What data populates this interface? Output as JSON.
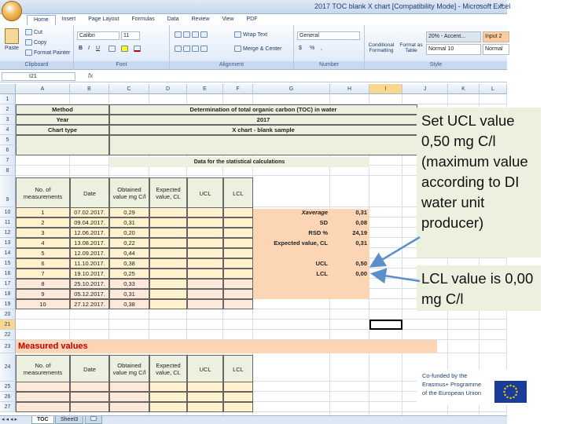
{
  "window": {
    "title": "2017 TOC blank X chart [Compatibility Mode] - Microsoft Excel",
    "controls": [
      "–",
      "▫",
      "×"
    ]
  },
  "ribbon": {
    "tabs": [
      "Home",
      "Insert",
      "Page Layout",
      "Formulas",
      "Data",
      "Review",
      "View",
      "PDF"
    ],
    "active_tab": "Home",
    "clipboard": {
      "paste": "Paste",
      "cut": "Cut",
      "copy": "Copy",
      "format_painter": "Format Painter",
      "label": "Clipboard"
    },
    "font": {
      "family": "Calibri",
      "size": "11",
      "bold": "B",
      "italic": "I",
      "underline": "U",
      "label": "Font"
    },
    "alignment": {
      "wrap": "Wrap Text",
      "merge": "Merge & Center",
      "label": "Alignment"
    },
    "number": {
      "format": "General",
      "currency": "$",
      "percent": "%",
      "comma": ",",
      "label": "Number"
    },
    "styles": {
      "conditional": "Conditional Formatting",
      "format_table": "Format as Table",
      "cells": [
        "20% - Accent...",
        "Input 2",
        "Normal 10",
        "Normal"
      ],
      "label": "Style"
    }
  },
  "formula_bar": {
    "name_box": "I21",
    "fx": "fx"
  },
  "grid": {
    "columns": [
      "A",
      "B",
      "C",
      "D",
      "E",
      "F",
      "G",
      "H",
      "I",
      "J",
      "K",
      "L"
    ],
    "rows": [
      "1",
      "2",
      "3",
      "4",
      "5",
      "6",
      "7",
      "8",
      "9",
      "10",
      "11",
      "12",
      "13",
      "14",
      "15",
      "16",
      "17",
      "18",
      "19",
      "20",
      "21",
      "22",
      "23",
      "24",
      "25",
      "26",
      "27"
    ]
  },
  "sheet": {
    "method_label": "Method",
    "year_label": "Year",
    "chart_type_label": "Chart type",
    "method_value": "Determination of total organic carbon (TOC) in water",
    "year_value": "2017",
    "chart_type_value": "X chart - blank sample",
    "stats_title": "Data for the statistical calculations",
    "headers": [
      "No. of measurements",
      "Date",
      "Obtained value mg C/l",
      "Expected value, CL",
      "UCL",
      "LCL"
    ],
    "measurements": [
      {
        "n": "1",
        "date": "07.02.2017.",
        "value": "0,29"
      },
      {
        "n": "2",
        "date": "09.04.2017.",
        "value": "0,31"
      },
      {
        "n": "3",
        "date": "12.06.2017.",
        "value": "0,20"
      },
      {
        "n": "4",
        "date": "13.08.2017.",
        "value": "0,22"
      },
      {
        "n": "5",
        "date": "12.09.2017.",
        "value": "0,44"
      },
      {
        "n": "6",
        "date": "11.10.2017.",
        "value": "0,38"
      },
      {
        "n": "7",
        "date": "19.10.2017.",
        "value": "0,25"
      },
      {
        "n": "8",
        "date": "25.10.2017.",
        "value": "0,33"
      },
      {
        "n": "9",
        "date": "05.12.2017.",
        "value": "0,31"
      },
      {
        "n": "10",
        "date": "27.12.2017.",
        "value": "0,38"
      }
    ],
    "stats": [
      {
        "label": "Xaverage",
        "value": "0,31"
      },
      {
        "label": "SD",
        "value": "0,08"
      },
      {
        "label": "RSD %",
        "value": "24,19"
      },
      {
        "label": "Expected value, CL",
        "value": "0,31"
      }
    ],
    "limits": [
      {
        "label": "UCL",
        "value": "0,50"
      },
      {
        "label": "LCL",
        "value": "0,00"
      }
    ],
    "measured_title": "Measured values",
    "headers2": [
      "No. of measurements",
      "Date",
      "Obtained value mg C/l",
      "Expected value, CL",
      "UCL",
      "LCL"
    ]
  },
  "sheet_tabs": [
    "TOC",
    "Sheet3"
  ],
  "active_sheet": "TOC",
  "callouts": {
    "ucl": "Set UCL value 0,50 mg C/l (maximum value according to DI water unit producer)",
    "lcl": "LCL value is 0,00 mg C/l"
  },
  "logo": {
    "text": [
      "Co-funded by the",
      "Erasmus+ Programme",
      "of the European Union"
    ]
  },
  "colors": {
    "green": "#ebf1de",
    "yellow": "#fff2cc",
    "orange": "#fcd5b4",
    "title_red": "#c00000",
    "arrow": "#5b8fc9",
    "eu_blue": "#1a3d99"
  }
}
